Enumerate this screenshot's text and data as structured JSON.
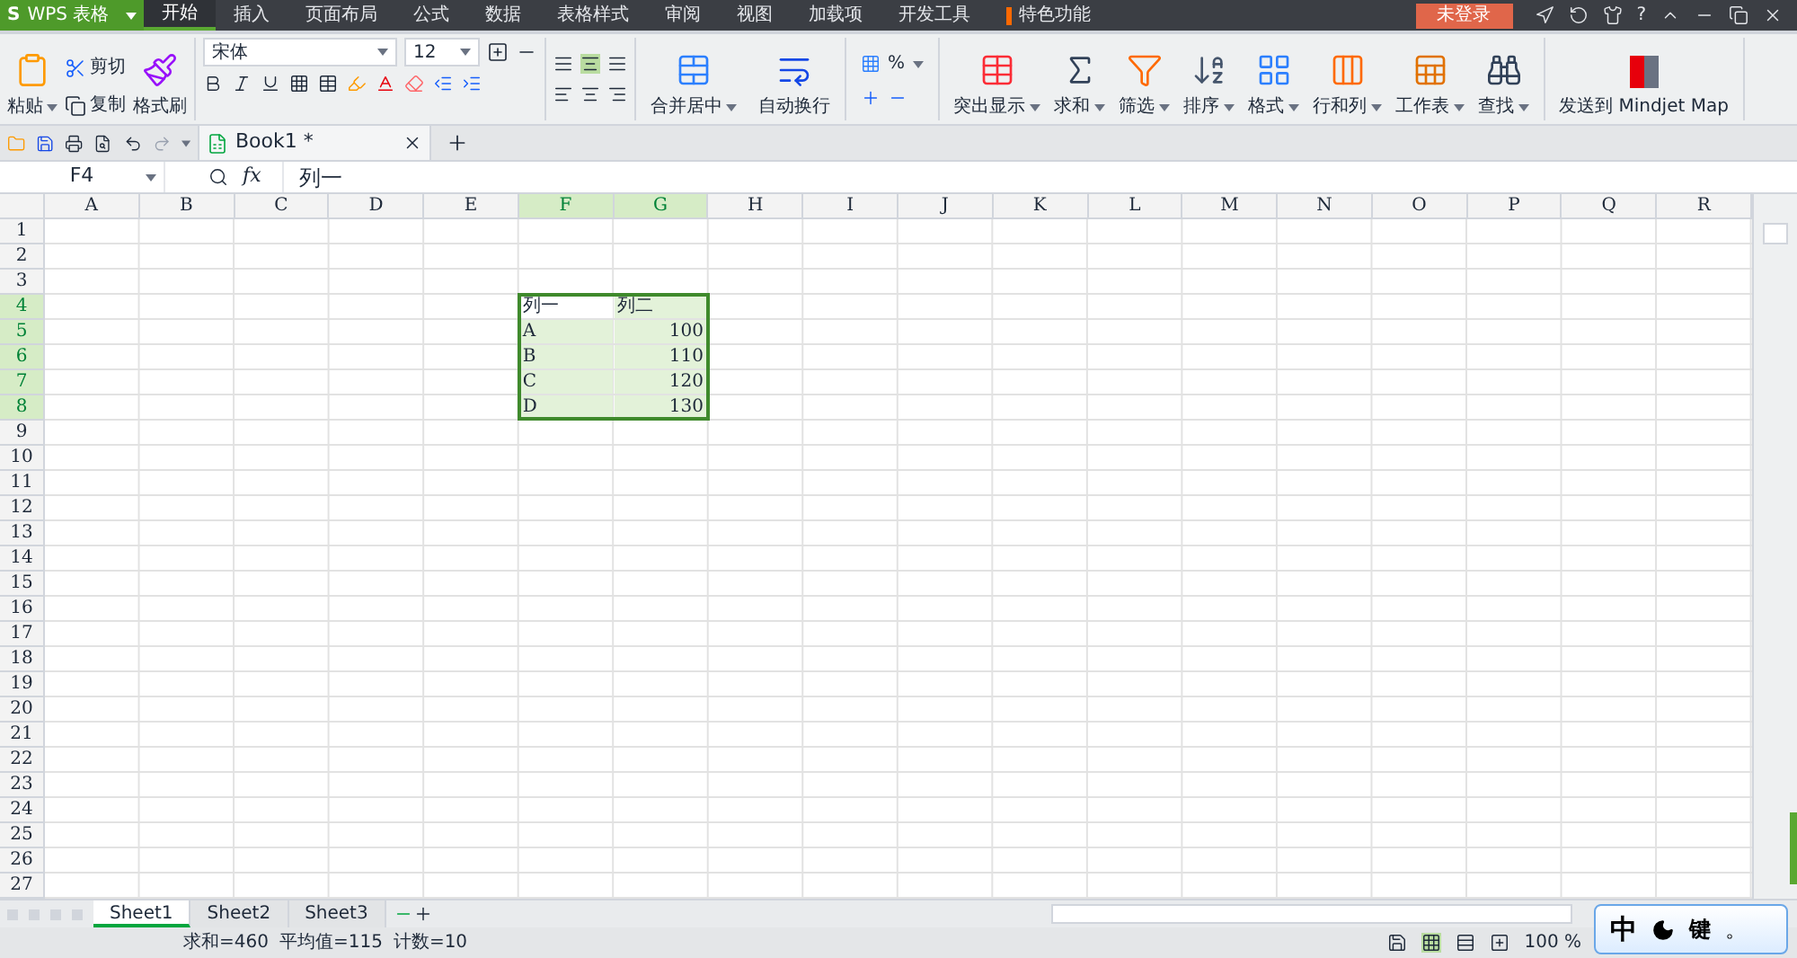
{
  "app": {
    "logo_mark": "S",
    "title": "WPS 表格",
    "login": "未登录",
    "help": "?"
  },
  "menu_tabs": [
    {
      "label": "开始",
      "selected": true,
      "kind": "plain"
    },
    {
      "label": "插入",
      "selected": false,
      "kind": "plain"
    },
    {
      "label": "页面布局",
      "selected": false,
      "kind": "plain"
    },
    {
      "label": "公式",
      "selected": false,
      "kind": "plain"
    },
    {
      "label": "数据",
      "selected": false,
      "kind": "plain"
    },
    {
      "label": "表格样式",
      "selected": false,
      "kind": "plain"
    },
    {
      "label": "审阅",
      "selected": false,
      "kind": "plain"
    },
    {
      "label": "视图",
      "selected": false,
      "kind": "plain"
    },
    {
      "label": "加载项",
      "selected": false,
      "kind": "plain"
    },
    {
      "label": "开发工具",
      "selected": false,
      "kind": "plain"
    },
    {
      "label": "特色功能",
      "selected": false,
      "kind": "marked"
    }
  ],
  "ribbon": {
    "paste": "粘贴",
    "cut": "剪切",
    "copy": "复制",
    "format_painter": "格式刷",
    "font_name": "宋体",
    "font_size": "12",
    "merge": "合并居中",
    "wrap": "自动换行",
    "percent": "%",
    "tools": [
      {
        "label": "突出显示",
        "kind": "highlight"
      },
      {
        "label": "求和",
        "kind": "sum"
      },
      {
        "label": "筛选",
        "kind": "filter"
      },
      {
        "label": "排序",
        "kind": "sort"
      },
      {
        "label": "格式",
        "kind": "format"
      },
      {
        "label": "行和列",
        "kind": "rowcol"
      },
      {
        "label": "工作表",
        "kind": "sheet"
      },
      {
        "label": "查找",
        "kind": "find"
      }
    ],
    "send": "发送到 Mindjet Map"
  },
  "doc_tab": {
    "title": "Book1 *"
  },
  "formula_bar": {
    "name_box": "F4",
    "fx": "fx",
    "value": "列一"
  },
  "columns": [
    {
      "label": "A",
      "selected": false
    },
    {
      "label": "B",
      "selected": false
    },
    {
      "label": "C",
      "selected": false
    },
    {
      "label": "D",
      "selected": false
    },
    {
      "label": "E",
      "selected": false
    },
    {
      "label": "F",
      "selected": true
    },
    {
      "label": "G",
      "selected": true
    },
    {
      "label": "H",
      "selected": false
    },
    {
      "label": "I",
      "selected": false
    },
    {
      "label": "J",
      "selected": false
    },
    {
      "label": "K",
      "selected": false
    },
    {
      "label": "L",
      "selected": false
    },
    {
      "label": "M",
      "selected": false
    },
    {
      "label": "N",
      "selected": false
    },
    {
      "label": "O",
      "selected": false
    },
    {
      "label": "P",
      "selected": false
    },
    {
      "label": "Q",
      "selected": false
    },
    {
      "label": "R",
      "selected": false
    }
  ],
  "rows": [
    {
      "label": "1",
      "selected": false
    },
    {
      "label": "2",
      "selected": false
    },
    {
      "label": "3",
      "selected": false
    },
    {
      "label": "4",
      "selected": true
    },
    {
      "label": "5",
      "selected": true
    },
    {
      "label": "6",
      "selected": true
    },
    {
      "label": "7",
      "selected": true
    },
    {
      "label": "8",
      "selected": true
    },
    {
      "label": "9",
      "selected": false
    },
    {
      "label": "10",
      "selected": false
    },
    {
      "label": "11",
      "selected": false
    },
    {
      "label": "12",
      "selected": false
    },
    {
      "label": "13",
      "selected": false
    },
    {
      "label": "14",
      "selected": false
    },
    {
      "label": "15",
      "selected": false
    },
    {
      "label": "16",
      "selected": false
    },
    {
      "label": "17",
      "selected": false
    },
    {
      "label": "18",
      "selected": false
    },
    {
      "label": "19",
      "selected": false
    },
    {
      "label": "20",
      "selected": false
    },
    {
      "label": "21",
      "selected": false
    },
    {
      "label": "22",
      "selected": false
    },
    {
      "label": "23",
      "selected": false
    },
    {
      "label": "24",
      "selected": false
    },
    {
      "label": "25",
      "selected": false
    },
    {
      "label": "26",
      "selected": false
    },
    {
      "label": "27",
      "selected": false
    }
  ],
  "data_block": [
    [
      {
        "text": "列一",
        "kind": "text"
      },
      {
        "text": "列二",
        "kind": "text"
      }
    ],
    [
      {
        "text": "A",
        "kind": "text"
      },
      {
        "text": "100",
        "kind": "number"
      }
    ],
    [
      {
        "text": "B",
        "kind": "text"
      },
      {
        "text": "110",
        "kind": "number"
      }
    ],
    [
      {
        "text": "C",
        "kind": "text"
      },
      {
        "text": "120",
        "kind": "number"
      }
    ],
    [
      {
        "text": "D",
        "kind": "text"
      },
      {
        "text": "130",
        "kind": "number"
      }
    ]
  ],
  "sheet_tabs": [
    {
      "label": "Sheet1",
      "selected": true
    },
    {
      "label": "Sheet2",
      "selected": false
    },
    {
      "label": "Sheet3",
      "selected": false
    }
  ],
  "status_bar": {
    "stats": [
      "求和=460",
      "平均值=115",
      "计数=10"
    ],
    "zoom": "100 %"
  },
  "ime": {
    "mode": "中",
    "key": "键",
    "punct": "。"
  }
}
